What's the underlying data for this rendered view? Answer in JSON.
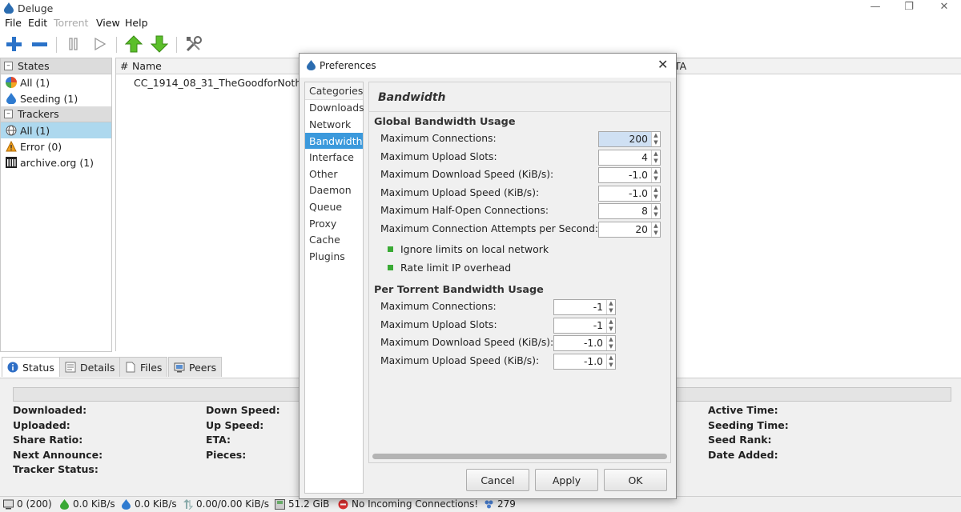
{
  "window": {
    "title": "Deluge"
  },
  "menu": [
    "File",
    "Edit",
    "Torrent",
    "View",
    "Help"
  ],
  "toolbar": {
    "icons": [
      "add-icon",
      "remove-icon",
      "pause-icon",
      "resume-icon",
      "queue-up-icon",
      "queue-down-icon",
      "preferences-icon"
    ]
  },
  "sidebar": {
    "states_header": "States",
    "states": [
      {
        "label": "All (1)",
        "icon": "all-icon"
      },
      {
        "label": "Seeding (1)",
        "icon": "seeding-icon"
      }
    ],
    "trackers_header": "Trackers",
    "trackers": [
      {
        "label": "All (1)",
        "icon": "globe-icon"
      },
      {
        "label": "Error (0)",
        "icon": "warning-icon"
      },
      {
        "label": "archive.org (1)",
        "icon": "archive-icon"
      }
    ]
  },
  "torrent_list": {
    "columns": {
      "num": "#",
      "name": "Name",
      "eta": "TA"
    },
    "rows": [
      {
        "name": "CC_1914_08_31_TheGoodforNoth"
      }
    ]
  },
  "tabs": [
    "Status",
    "Details",
    "Files",
    "Peers"
  ],
  "status_labels": {
    "col1": [
      "Downloaded:",
      "Uploaded:",
      "Share Ratio:",
      "Next Announce:",
      "Tracker Status:"
    ],
    "col2": [
      "Down Speed:",
      "Up Speed:",
      "ETA:",
      "Pieces:"
    ],
    "col4": [
      "Active Time:",
      "Seeding Time:",
      "Seed Rank:",
      "Date Added:"
    ]
  },
  "statusbar": {
    "connections": "0 (200)",
    "down": "0.0 KiB/s",
    "up": "0.0 KiB/s",
    "protocol": "0.00/0.00 KiB/s",
    "disk": "51.2 GiB",
    "incoming": "No Incoming Connections!",
    "dht": "279"
  },
  "dialog": {
    "title": "Preferences",
    "categories_header": "Categories",
    "categories": [
      "Downloads",
      "Network",
      "Bandwidth",
      "Interface",
      "Other",
      "Daemon",
      "Queue",
      "Proxy",
      "Cache",
      "Plugins"
    ],
    "selected_category": "Bandwidth",
    "panel_title": "Bandwidth",
    "global_title": "Global Bandwidth Usage",
    "global": [
      {
        "label": "Maximum Connections:",
        "value": "200"
      },
      {
        "label": "Maximum Upload Slots:",
        "value": "4"
      },
      {
        "label": "Maximum Download Speed (KiB/s):",
        "value": "-1.0"
      },
      {
        "label": "Maximum Upload Speed (KiB/s):",
        "value": "-1.0"
      },
      {
        "label": "Maximum Half-Open Connections:",
        "value": "8"
      },
      {
        "label": "Maximum Connection Attempts per Second:",
        "value": "20"
      }
    ],
    "checks": [
      {
        "label": "Ignore limits on local network",
        "checked": true
      },
      {
        "label": "Rate limit IP overhead",
        "checked": true
      }
    ],
    "per_title": "Per Torrent Bandwidth Usage",
    "per": [
      {
        "label": "Maximum Connections:",
        "value": "-1"
      },
      {
        "label": "Maximum Upload Slots:",
        "value": "-1"
      },
      {
        "label": "Maximum Download Speed (KiB/s):",
        "value": "-1.0"
      },
      {
        "label": "Maximum Upload Speed (KiB/s):",
        "value": "-1.0"
      }
    ],
    "buttons": {
      "cancel": "Cancel",
      "apply": "Apply",
      "ok": "OK"
    }
  },
  "colors": {
    "accent": "#3b99dc",
    "selection": "#add8ee",
    "check": "#3aaa35"
  }
}
